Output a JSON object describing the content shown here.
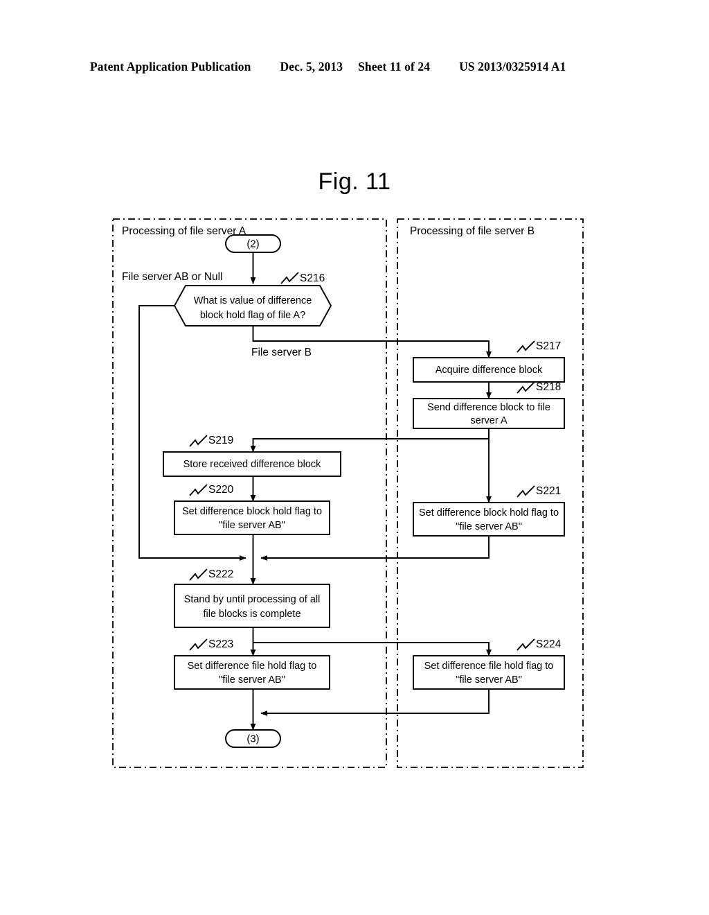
{
  "header": {
    "publication": "Patent Application Publication",
    "date": "Dec. 5, 2013",
    "sheet": "Sheet 11 of 24",
    "number": "US 2013/0325914 A1"
  },
  "figure": {
    "title": "Fig. 11"
  },
  "lanes": [
    {
      "id": "lane-a",
      "title": "Processing of file server A"
    },
    {
      "id": "lane-b",
      "title": "Processing of file server B"
    }
  ],
  "connectors": {
    "entry": "(2)",
    "exit": "(3)"
  },
  "branch_labels": {
    "left": "File server AB or Null",
    "down": "File server B"
  },
  "steps": [
    {
      "id": "S216",
      "tag": "S216",
      "shape": "decision",
      "text_lines": [
        "What is value of difference",
        "block hold flag of file A?"
      ],
      "lane": "lane-a"
    },
    {
      "id": "S217",
      "tag": "S217",
      "shape": "process",
      "text_lines": [
        "Acquire difference block"
      ],
      "lane": "lane-b"
    },
    {
      "id": "S218",
      "tag": "S218",
      "shape": "process",
      "text_lines": [
        "Send difference block to file",
        "server A"
      ],
      "lane": "lane-b"
    },
    {
      "id": "S219",
      "tag": "S219",
      "shape": "process",
      "text_lines": [
        "Store received difference block"
      ],
      "lane": "lane-a"
    },
    {
      "id": "S220",
      "tag": "S220",
      "shape": "process",
      "text_lines": [
        "Set difference block hold flag to",
        "\"file server AB\""
      ],
      "lane": "lane-a"
    },
    {
      "id": "S221",
      "tag": "S221",
      "shape": "process",
      "text_lines": [
        "Set difference block hold flag to",
        "\"file server AB\""
      ],
      "lane": "lane-b"
    },
    {
      "id": "S222",
      "tag": "S222",
      "shape": "process",
      "text_lines": [
        "Stand by until processing of all",
        "file blocks is complete"
      ],
      "lane": "lane-a"
    },
    {
      "id": "S223",
      "tag": "S223",
      "shape": "process",
      "text_lines": [
        "Set difference file hold flag to",
        "\"file server AB\""
      ],
      "lane": "lane-a"
    },
    {
      "id": "S224",
      "tag": "S224",
      "shape": "process",
      "text_lines": [
        "Set difference file hold flag to",
        "\"file server AB\""
      ],
      "lane": "lane-b"
    }
  ],
  "colors": {
    "ink": "#000000",
    "paper": "#ffffff"
  }
}
